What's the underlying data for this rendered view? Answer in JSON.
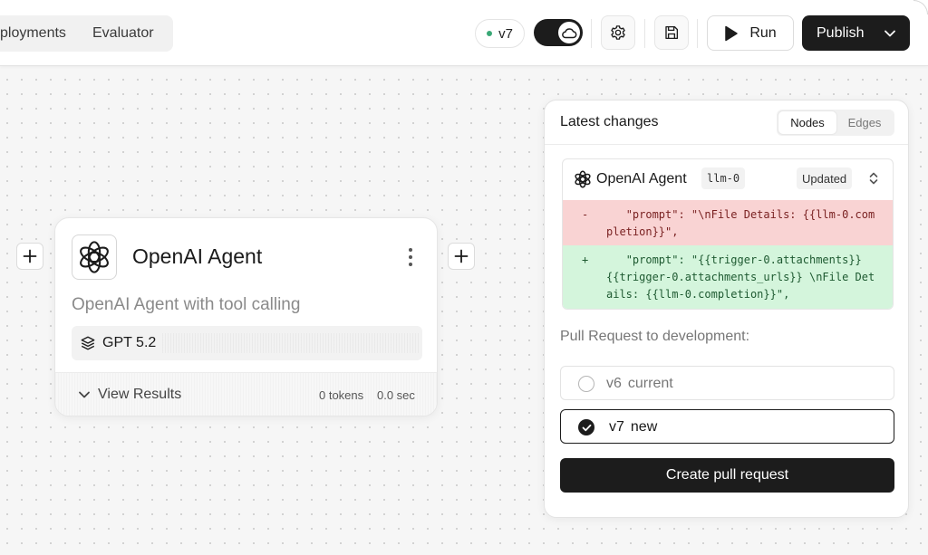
{
  "topbar": {
    "tabs": [
      {
        "label": "ployments"
      },
      {
        "label": "Evaluator"
      }
    ],
    "version_badge": "v7",
    "run_label": "Run",
    "publish_label": "Publish",
    "icons": {
      "toggle": "cloud-icon",
      "settings": "gear-icon",
      "save": "floppy-disk-icon",
      "run": "play-icon",
      "publish": "chevron-down-icon"
    }
  },
  "node": {
    "title": "OpenAI Agent",
    "description": "OpenAI Agent with tool calling",
    "model": "GPT 5.2",
    "view_results_label": "View Results",
    "tokens": "0 tokens",
    "duration": "0.0 sec",
    "icons": {
      "logo": "openai-logo-icon",
      "menu": "vertical-ellipsis-icon",
      "model": "layers-icon",
      "expand": "chevron-down-icon",
      "add_left": "plus-icon",
      "add_right": "plus-icon"
    }
  },
  "changes_panel": {
    "title": "Latest changes",
    "tabs": [
      {
        "label": "Nodes",
        "active": true
      },
      {
        "label": "Edges",
        "active": false
      }
    ],
    "diff": {
      "agent_name": "OpenAI Agent",
      "node_id": "llm-0",
      "status": "Updated",
      "removed_sign": "-",
      "removed_text": "   \"prompt\": \"\\nFile Details: {{llm-0.completion}}\",",
      "added_sign": "+",
      "added_text": "   \"prompt\": \"{{trigger-0.attachments}} {{trigger-0.attachments_urls}} \\nFile Details: {{llm-0.completion}}\","
    },
    "pr_label": "Pull Request to development:",
    "options": [
      {
        "version": "v6",
        "tag": "current",
        "selected": false
      },
      {
        "version": "v7",
        "tag": "new",
        "selected": true
      }
    ],
    "create_label": "Create pull request"
  },
  "colors": {
    "primary_dark": "#1c1c1c",
    "diff_removed_bg": "#f9d3d3",
    "diff_added_bg": "#d4f5dc",
    "status_dot": "#3aa876"
  }
}
